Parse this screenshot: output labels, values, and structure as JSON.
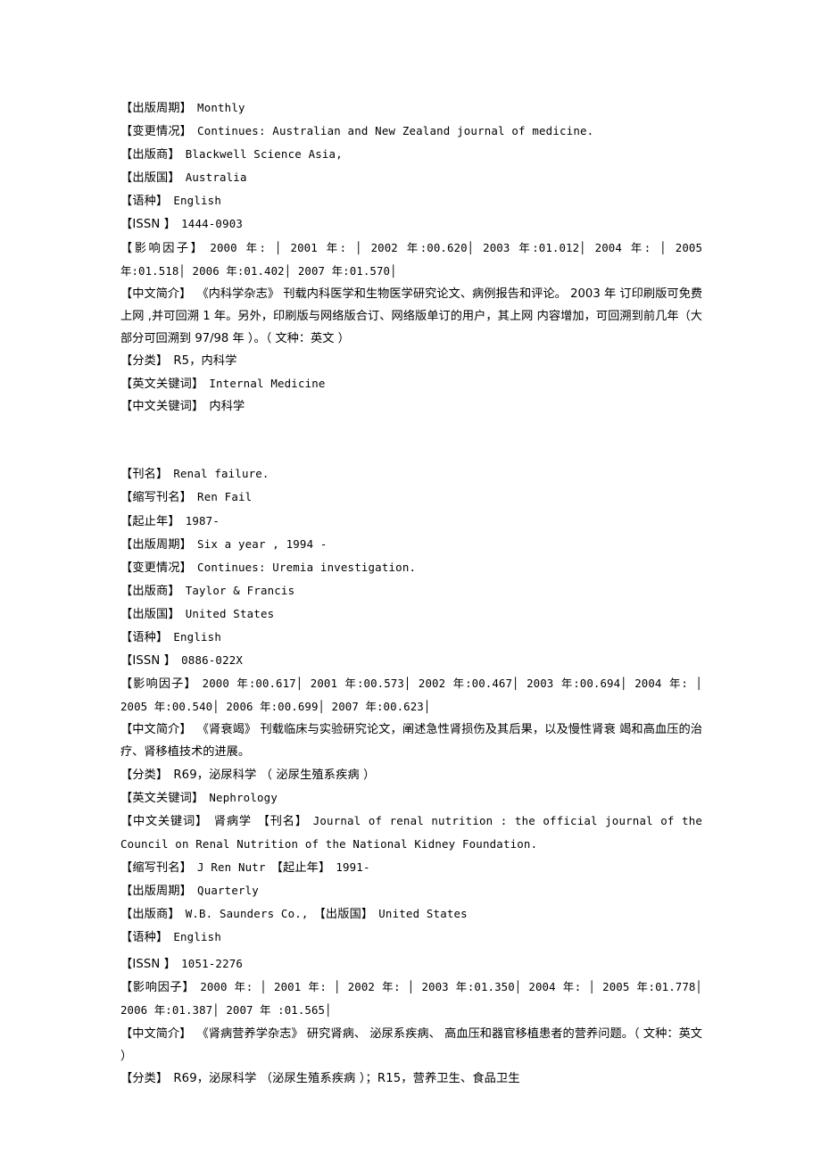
{
  "document": {
    "kind": "journal-catalog-page",
    "background_color": "#ffffff",
    "text_color": "#000000"
  },
  "labels": {
    "title": "【刊名】",
    "abbrev": "【缩写刊名】",
    "years": "【起止年】",
    "frequency": "【出版周期】",
    "changes": "【变更情况】",
    "publisher": "【出版商】",
    "country": "【出版国】",
    "language": "【语种】",
    "issn": "【ISSN 】",
    "impact_factor": "【影响因子】",
    "summary": "【中文简介】",
    "classification": "【分类】",
    "en_keywords": "【英文关键词】",
    "cn_keywords": "【中文关键词】"
  },
  "entries": [
    {
      "id": "internal-medicine-journal",
      "frequency": "Monthly",
      "changes": "Continues: Australian and New Zealand journal of medicine.",
      "publisher": "Blackwell Science Asia,",
      "country": "Australia",
      "language": "English",
      "issn": "1444-0903",
      "impact_factor": "2000 年: │ 2001 年: │ 2002 年:00.620│ 2003 年:01.012│ 2004 年: │ 2005 年:01.518│ 2006 年:01.402│ 2007 年:01.570│",
      "summary": "《内科学杂志》 刊载内科医学和生物医学研究论文、病例报告和评论。 2003 年 订印刷版可免费上网 ,并可回溯 1 年。另外，印刷版与网络版合订、网络版单订的用户，其上网 内容增加，可回溯到前几年（大部分可回溯到 97/98 年 ）。（ 文种：英文 ）",
      "classification": "R5，内科学",
      "en_keywords": "Internal Medicine",
      "cn_keywords": "内科学"
    },
    {
      "id": "renal-failure",
      "title": "Renal failure.",
      "abbrev": "Ren Fail",
      "years": "1987-",
      "frequency": "Six a year , 1994 -",
      "changes": "Continues: Uremia investigation.",
      "publisher": "Taylor & Francis",
      "country": "United States",
      "language": "English",
      "issn": "0886-022X",
      "impact_factor": "2000 年:00.617│ 2001 年:00.573│ 2002 年:00.467│ 2003 年:00.694│ 2004 年: │ 2005 年:00.540│ 2006 年:00.699│ 2007 年:00.623│",
      "summary": "《肾衰竭》 刊载临床与实验研究论文，阐述急性肾损伤及其后果，以及慢性肾衰 竭和高血压的治疗、肾移植技术的进展。",
      "classification": "R69，泌尿科学 （ 泌尿生殖系疾病 ）",
      "en_keywords": "Nephrology",
      "cn_keywords": "肾病学"
    },
    {
      "id": "journal-of-renal-nutrition",
      "title": "Journal of renal nutrition : the official journal of the Council on Renal Nutrition of the National Kidney Foundation.",
      "abbrev": "J Ren Nutr",
      "years": "1991-",
      "frequency": "Quarterly",
      "publisher": "W.B. Saunders Co.,",
      "country": "United States",
      "language": "English",
      "issn": "1051-2276",
      "impact_factor": "2000 年: │ 2001 年: │ 2002 年: │ 2003 年:01.350│ 2004 年: │ 2005 年:01.778│ 2006 年:01.387│ 2007 年 :01.565│",
      "summary": "《肾病营养学杂志》 研究肾病、 泌尿系疾病、 高血压和器官移植患者的营养问题。（ 文种：英文 ）",
      "classification": "R69，泌尿科学 （泌尿生殖系疾病 ）；R15，营养卫生、食品卫生"
    }
  ]
}
